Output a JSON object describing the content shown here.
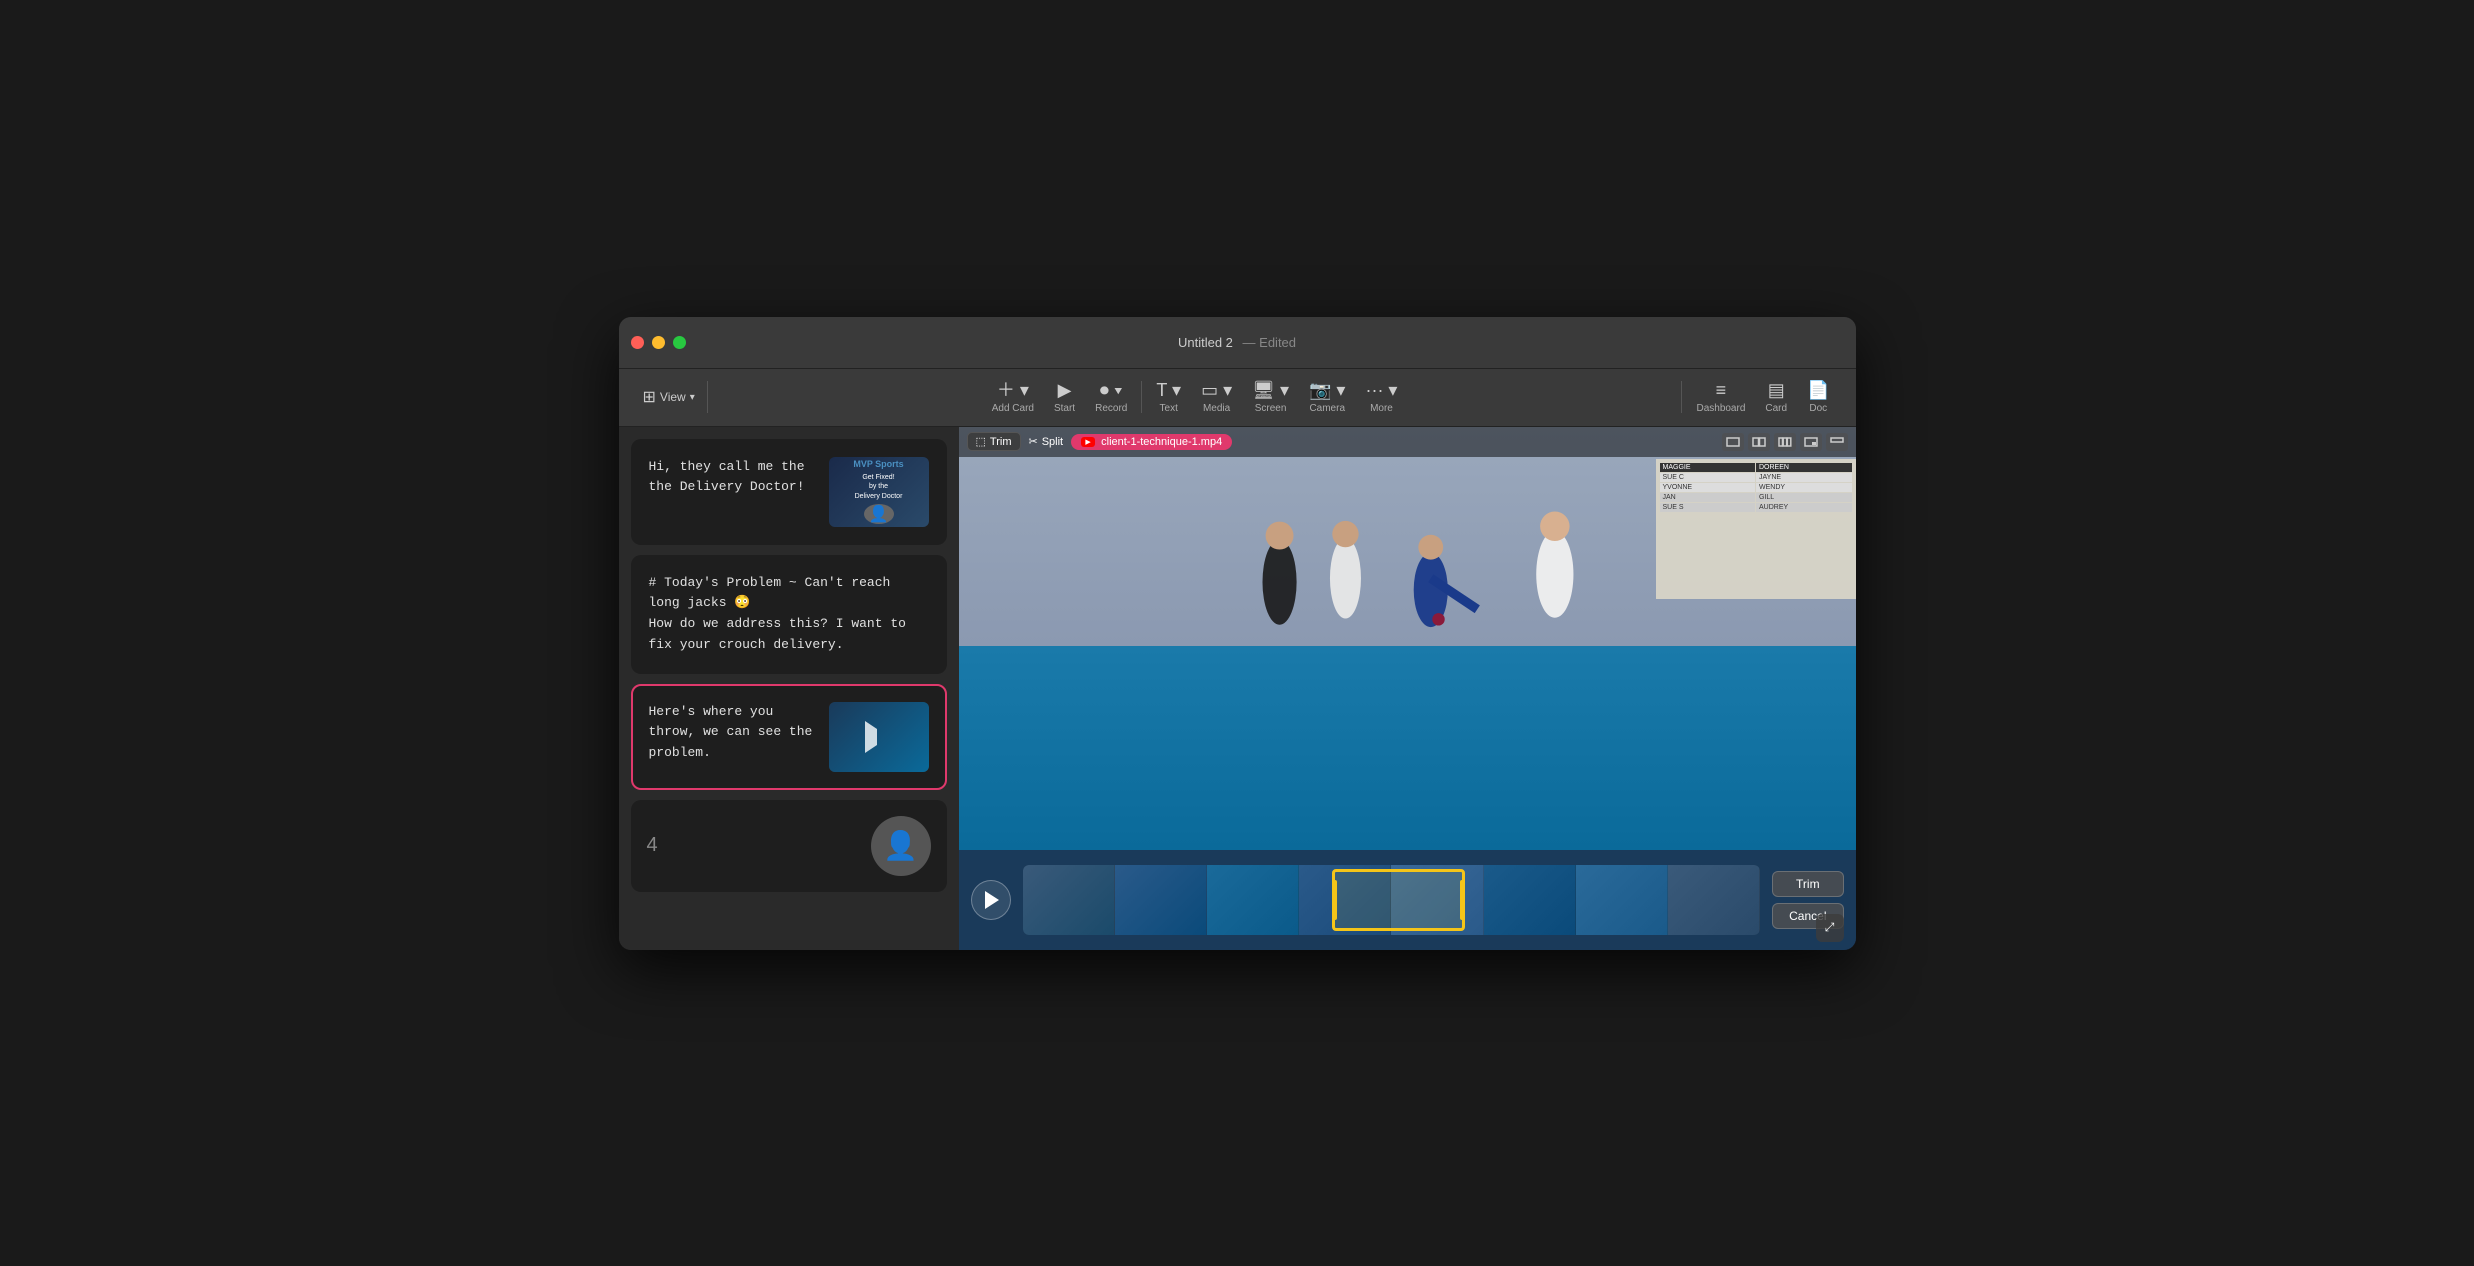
{
  "window": {
    "title": "Untitled 2",
    "subtitle": "Edited",
    "traffic_lights": [
      "close",
      "minimize",
      "maximize"
    ]
  },
  "toolbar": {
    "view_label": "View",
    "add_card_label": "Add Card",
    "start_label": "Start",
    "record_label": "Record",
    "text_label": "Text",
    "media_label": "Media",
    "screen_label": "Screen",
    "camera_label": "Camera",
    "more_label": "More",
    "dashboard_label": "Dashboard",
    "card_label": "Card",
    "doc_label": "Doc"
  },
  "cards": [
    {
      "id": 1,
      "text": "Hi, they call me the the Delivery Doctor!",
      "has_thumbnail": true,
      "thumbnail_type": "book",
      "book_top": "MVP Sports",
      "book_bottom": "Get Fixed! by the Delivery Doctor",
      "selected": false
    },
    {
      "id": 2,
      "text": "# Today's Problem ~ Can't reach long jacks 😳\nHow do we address this? I want to fix your crouch delivery.",
      "has_thumbnail": false,
      "selected": false
    },
    {
      "id": 3,
      "text": "Here's where you throw, we can see the problem.",
      "has_thumbnail": true,
      "thumbnail_type": "video",
      "selected": true
    },
    {
      "id": 4,
      "number": "4",
      "has_avatar": true,
      "selected": false
    }
  ],
  "video_panel": {
    "trim_label": "Trim",
    "split_label": "Split",
    "file_name": "client-1-technique-1.mp4",
    "trim_btn": "Trim",
    "cancel_btn": "Cancel"
  }
}
